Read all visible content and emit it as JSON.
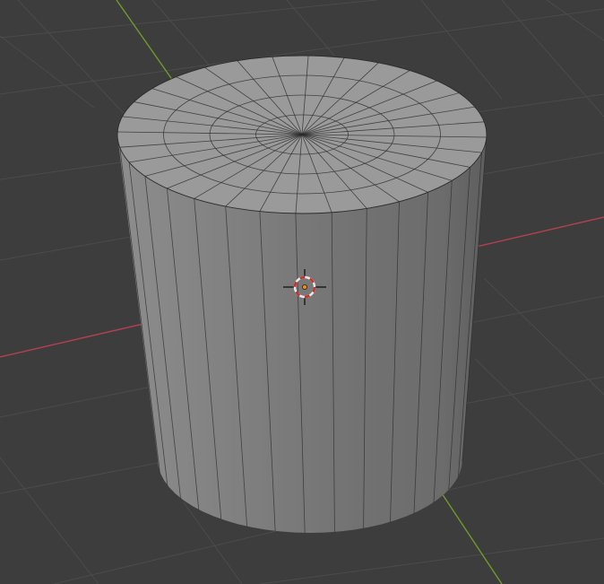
{
  "viewport": {
    "mode": "object",
    "background_color": "#3d3d3d",
    "grid_color": "#4b4b4b",
    "x_axis_color": "#b34150",
    "y_axis_color": "#6f9a2c"
  },
  "object": {
    "type": "cylinder",
    "segments": 32,
    "top_rings": 4,
    "side_color": "#8f8f8f",
    "cap_color": "#9a9a9a",
    "wire_color": "#2c2c2c"
  },
  "cursor_3d": {
    "ring_colors": [
      "#e8e8e8",
      "#d02a2a"
    ],
    "origin_color": "#f08a1a"
  }
}
